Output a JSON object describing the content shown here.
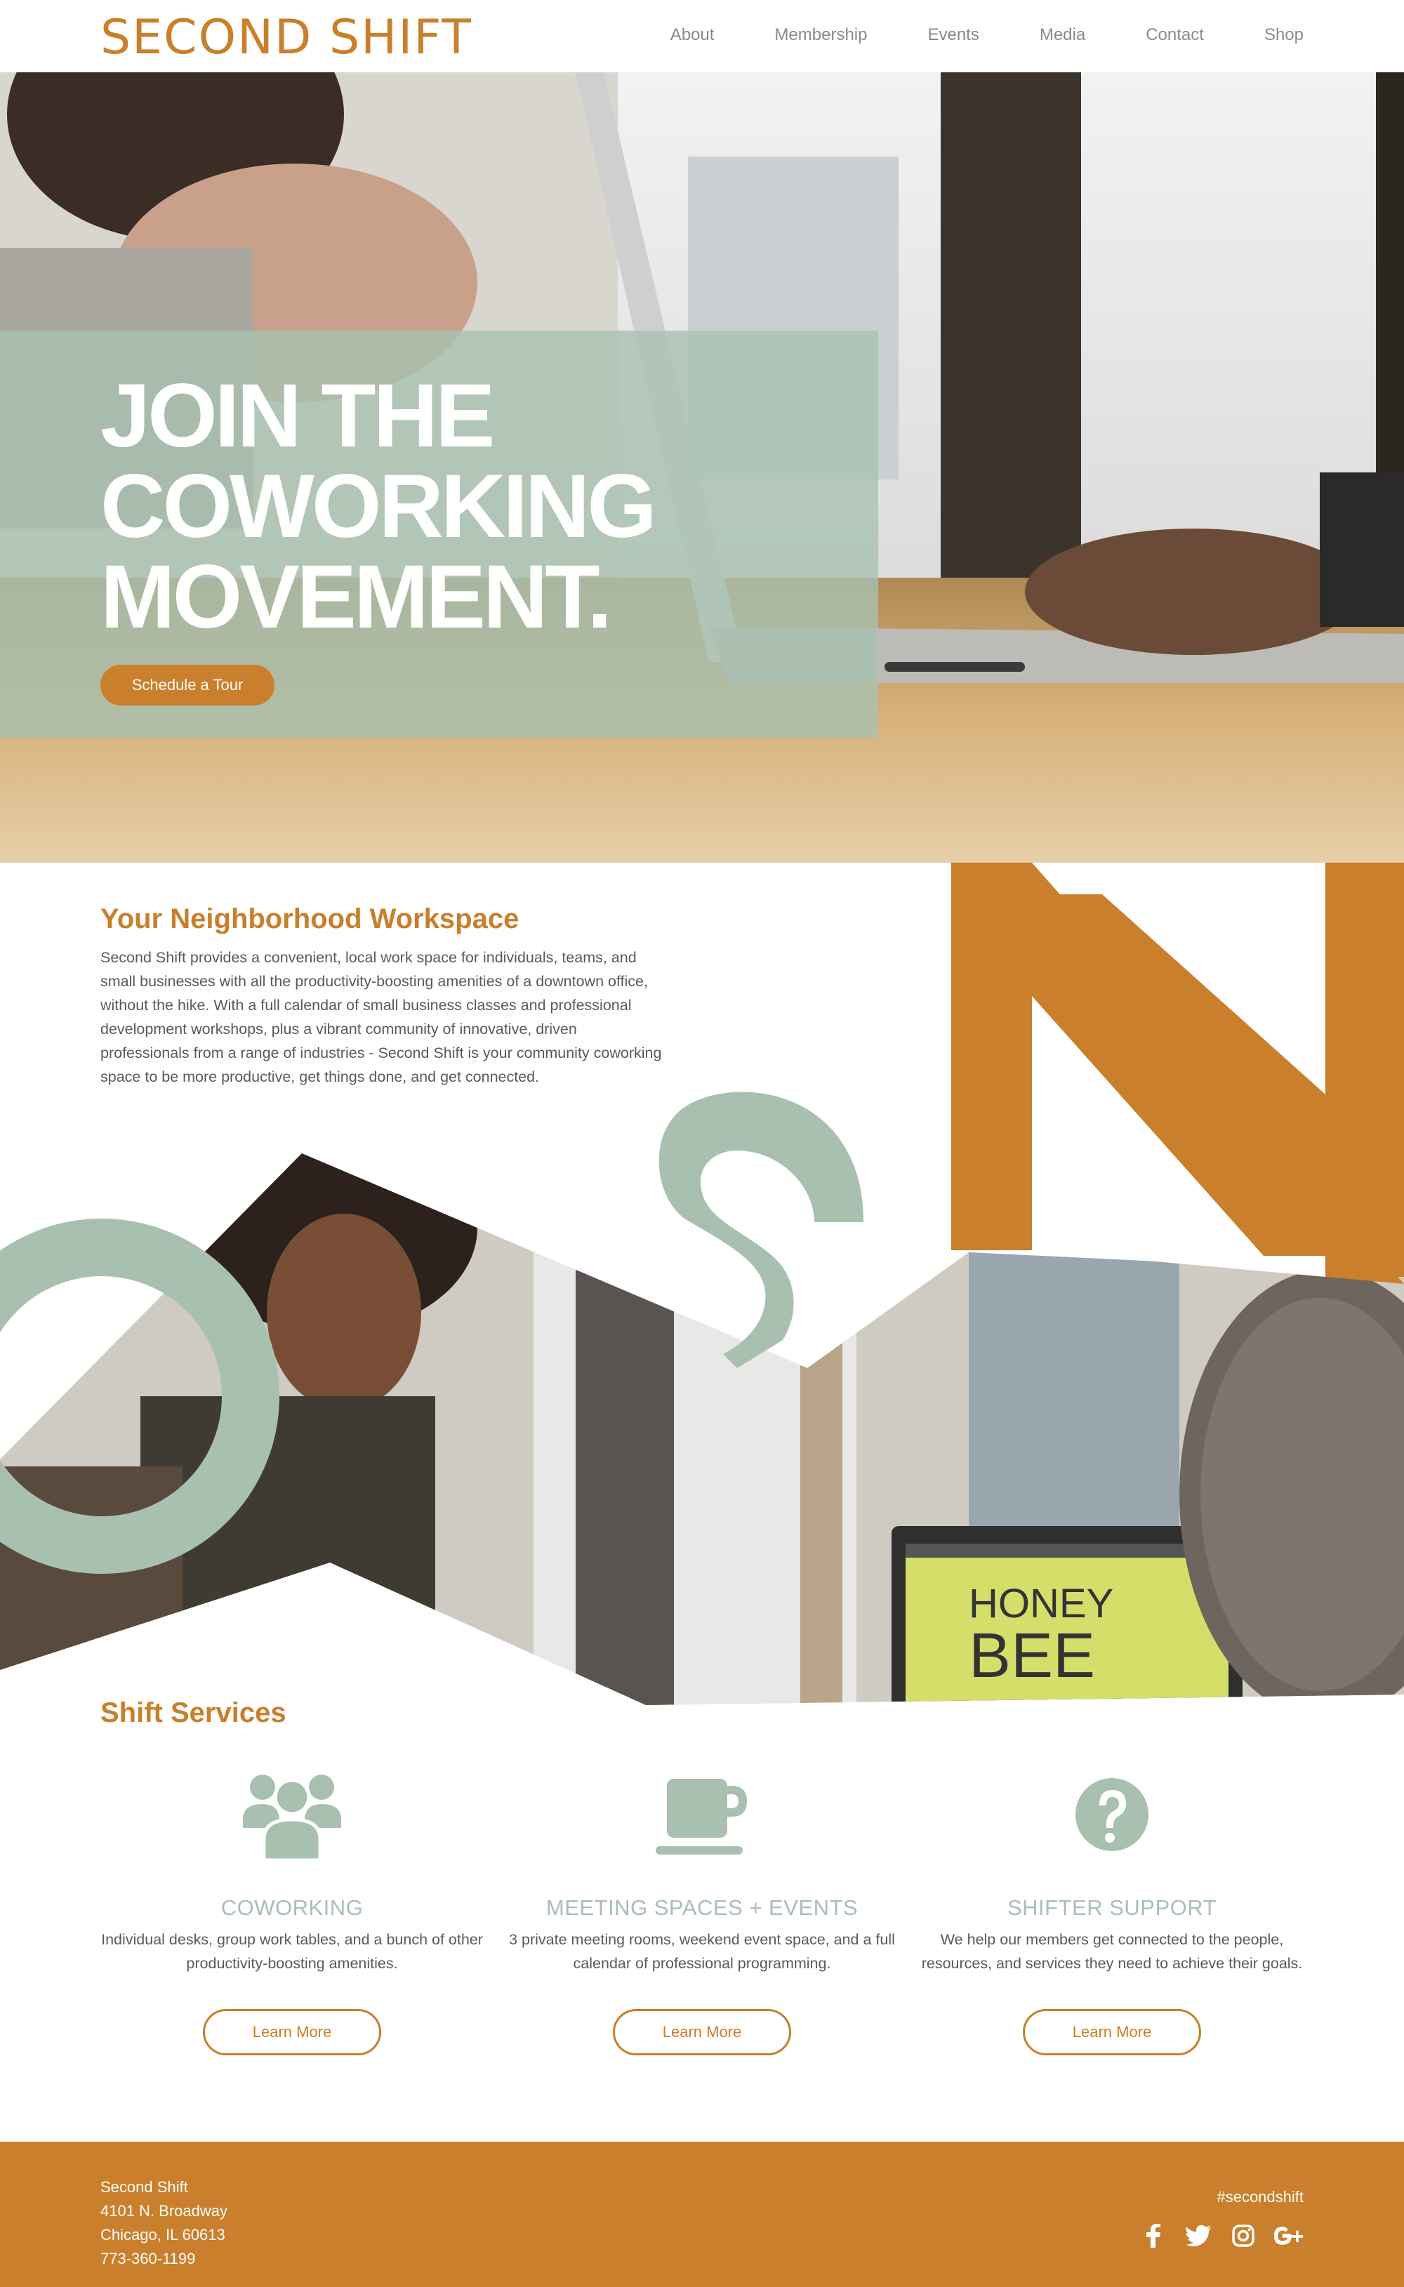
{
  "header": {
    "logo": "SECOND SHIFT",
    "nav": [
      "About",
      "Membership",
      "Events",
      "Media",
      "Contact",
      "Shop"
    ]
  },
  "hero": {
    "title_lines": [
      "JOIN THE",
      "COWORKING",
      "MOVEMENT."
    ],
    "cta": "Schedule a Tour"
  },
  "neighborhood": {
    "title": "Your Neighborhood Workspace",
    "text": "Second Shift provides a convenient, local work space for individuals, teams, and small businesses with all the productivity-boosting amenities of a downtown office, without the hike. With a full calendar of small business classes and professional development workshops, plus a vibrant community of innovative, driven professionals from a range of industries - Second Shift is your community coworking space to be more productive, get things done, and get connected.",
    "laptop_screen_text": [
      "HONEY",
      "BEE"
    ]
  },
  "services": {
    "title": "Shift Services",
    "items": [
      {
        "icon": "group-icon",
        "heading": "COWORKING",
        "description": "Individual desks, group work tables, and a bunch of other productivity-boosting amenities.",
        "button": "Learn More"
      },
      {
        "icon": "coffee-cup-icon",
        "heading": "MEETING SPACES + EVENTS",
        "description": "3 private meeting rooms, weekend event space, and a full calendar of professional programming.",
        "button": "Learn More"
      },
      {
        "icon": "question-icon",
        "heading": "SHIFTER SUPPORT",
        "description": "We help our members get connected to the people, resources, and services they need to achieve their goals.",
        "button": "Learn More"
      }
    ]
  },
  "footer": {
    "address_lines": [
      "Second Shift",
      "4101 N. Broadway",
      "Chicago, IL 60613",
      "773-360-1199"
    ],
    "hashtag": "#secondshift",
    "social": [
      "facebook-icon",
      "twitter-icon",
      "instagram-icon",
      "google-plus-icon"
    ]
  },
  "colors": {
    "accent": "#c97f2b",
    "sage": "#a8c0b0",
    "text": "#5a5a5a",
    "nav_text": "#8a8a8a"
  }
}
